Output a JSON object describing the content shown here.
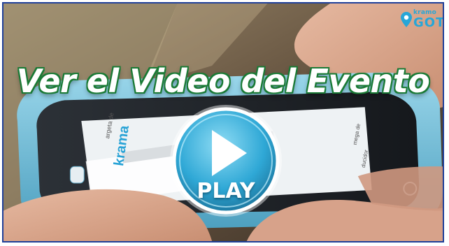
{
  "video": {
    "title": "Ver el Video del Evento",
    "play_label": "PLAY",
    "logo": {
      "text_top": "kramo",
      "text_main": "GOT"
    }
  },
  "screen_text": {
    "brand": "krama",
    "line1": "argeta de",
    "line2": "mega de",
    "line3": "ducidor"
  },
  "colors": {
    "frame_border": "#1f3f99",
    "title_outline": "#1a7a35",
    "phone_case": "#79c6df",
    "play_button": "#2fa8d6"
  }
}
